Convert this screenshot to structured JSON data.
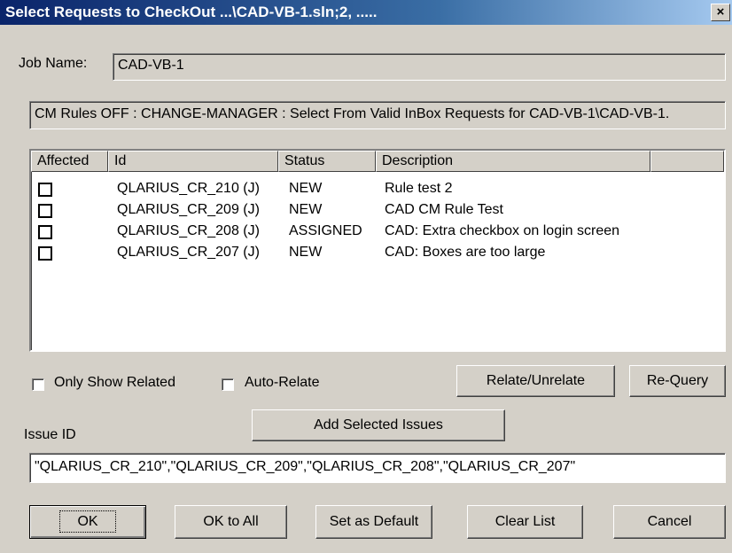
{
  "window": {
    "title": "Select Requests to CheckOut ...\\CAD-VB-1.sln;2, .....",
    "close_glyph": "×"
  },
  "job": {
    "label": "Job Name:",
    "value": "CAD-VB-1"
  },
  "rules_text": "CM Rules OFF : CHANGE-MANAGER : Select From Valid InBox Requests for CAD-VB-1\\CAD-VB-1.",
  "list": {
    "columns": [
      "Affected",
      "Id",
      "Status",
      "Description",
      ""
    ],
    "rows": [
      {
        "id": "QLARIUS_CR_210 (J)",
        "status": "NEW",
        "description": "Rule test 2"
      },
      {
        "id": "QLARIUS_CR_209 (J)",
        "status": "NEW",
        "description": "CAD CM Rule Test"
      },
      {
        "id": "QLARIUS_CR_208 (J)",
        "status": "ASSIGNED",
        "description": "CAD: Extra checkbox on login screen"
      },
      {
        "id": "QLARIUS_CR_207 (J)",
        "status": "NEW",
        "description": "CAD: Boxes are too large"
      }
    ]
  },
  "options": {
    "only_show_related": "Only Show Related",
    "auto_relate": "Auto-Relate"
  },
  "buttons": {
    "relate_unrelate": "Relate/Unrelate",
    "requery": "Re-Query",
    "add_selected": "Add Selected Issues",
    "ok": "OK",
    "ok_all": "OK to All",
    "set_default": "Set as Default",
    "clear_list": "Clear List",
    "cancel": "Cancel"
  },
  "issue": {
    "label": "Issue ID",
    "value": "\"QLARIUS_CR_210\",\"QLARIUS_CR_209\",\"QLARIUS_CR_208\",\"QLARIUS_CR_207\""
  }
}
